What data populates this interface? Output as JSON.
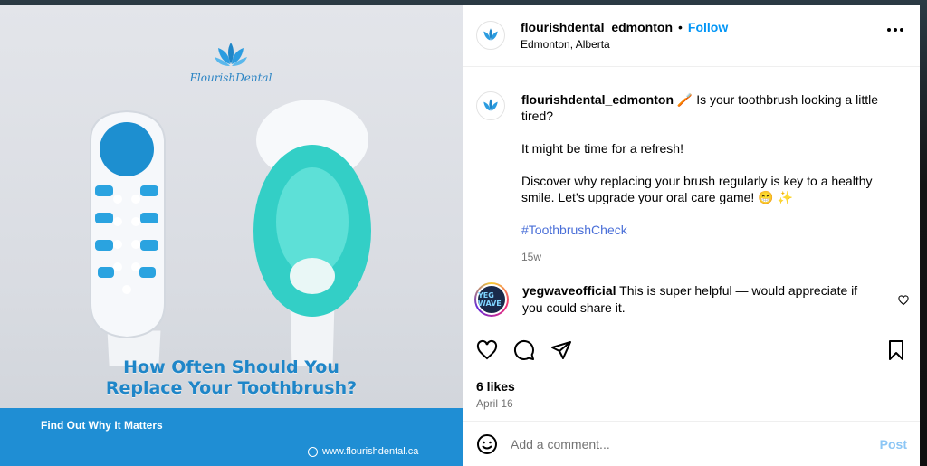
{
  "post": {
    "image": {
      "brand_name": "FlourishDental",
      "headline_line1": "How Often Should You",
      "headline_line2": "Replace Your Toothbrush?",
      "band_text": "Find Out Why It Matters",
      "band_url": "www.flourishdental.ca"
    },
    "header": {
      "username": "flourishdental_edmonton",
      "separator": "•",
      "follow_label": "Follow",
      "location": "Edmonton, Alberta"
    },
    "caption": {
      "username": "flourishdental_edmonton",
      "line1": "🪥 Is your toothbrush looking a little tired?",
      "line2": "It might be time for a refresh!",
      "line3": "Discover why replacing your brush regularly is key to a healthy smile. Let’s upgrade your oral care game! 😁 ✨",
      "hashtag": "#ToothbrushCheck",
      "age": "15w"
    },
    "comment": {
      "username": "yegwaveofficial",
      "text": "This is super helpful — would appreciate if you could share it.",
      "avatar_text": "YEG WAVE"
    },
    "likes": "6 likes",
    "date": "April 16",
    "add_comment": {
      "placeholder": "Add a comment...",
      "post_label": "Post"
    },
    "icons": [
      "more-icon",
      "heart-icon",
      "comment-icon",
      "share-icon",
      "bookmark-icon",
      "emoji-icon",
      "small-heart-icon"
    ],
    "colors": {
      "accent": "#0095f6",
      "brand_blue": "#1f8ed4",
      "teal_brush": "#2fd3c7"
    }
  }
}
